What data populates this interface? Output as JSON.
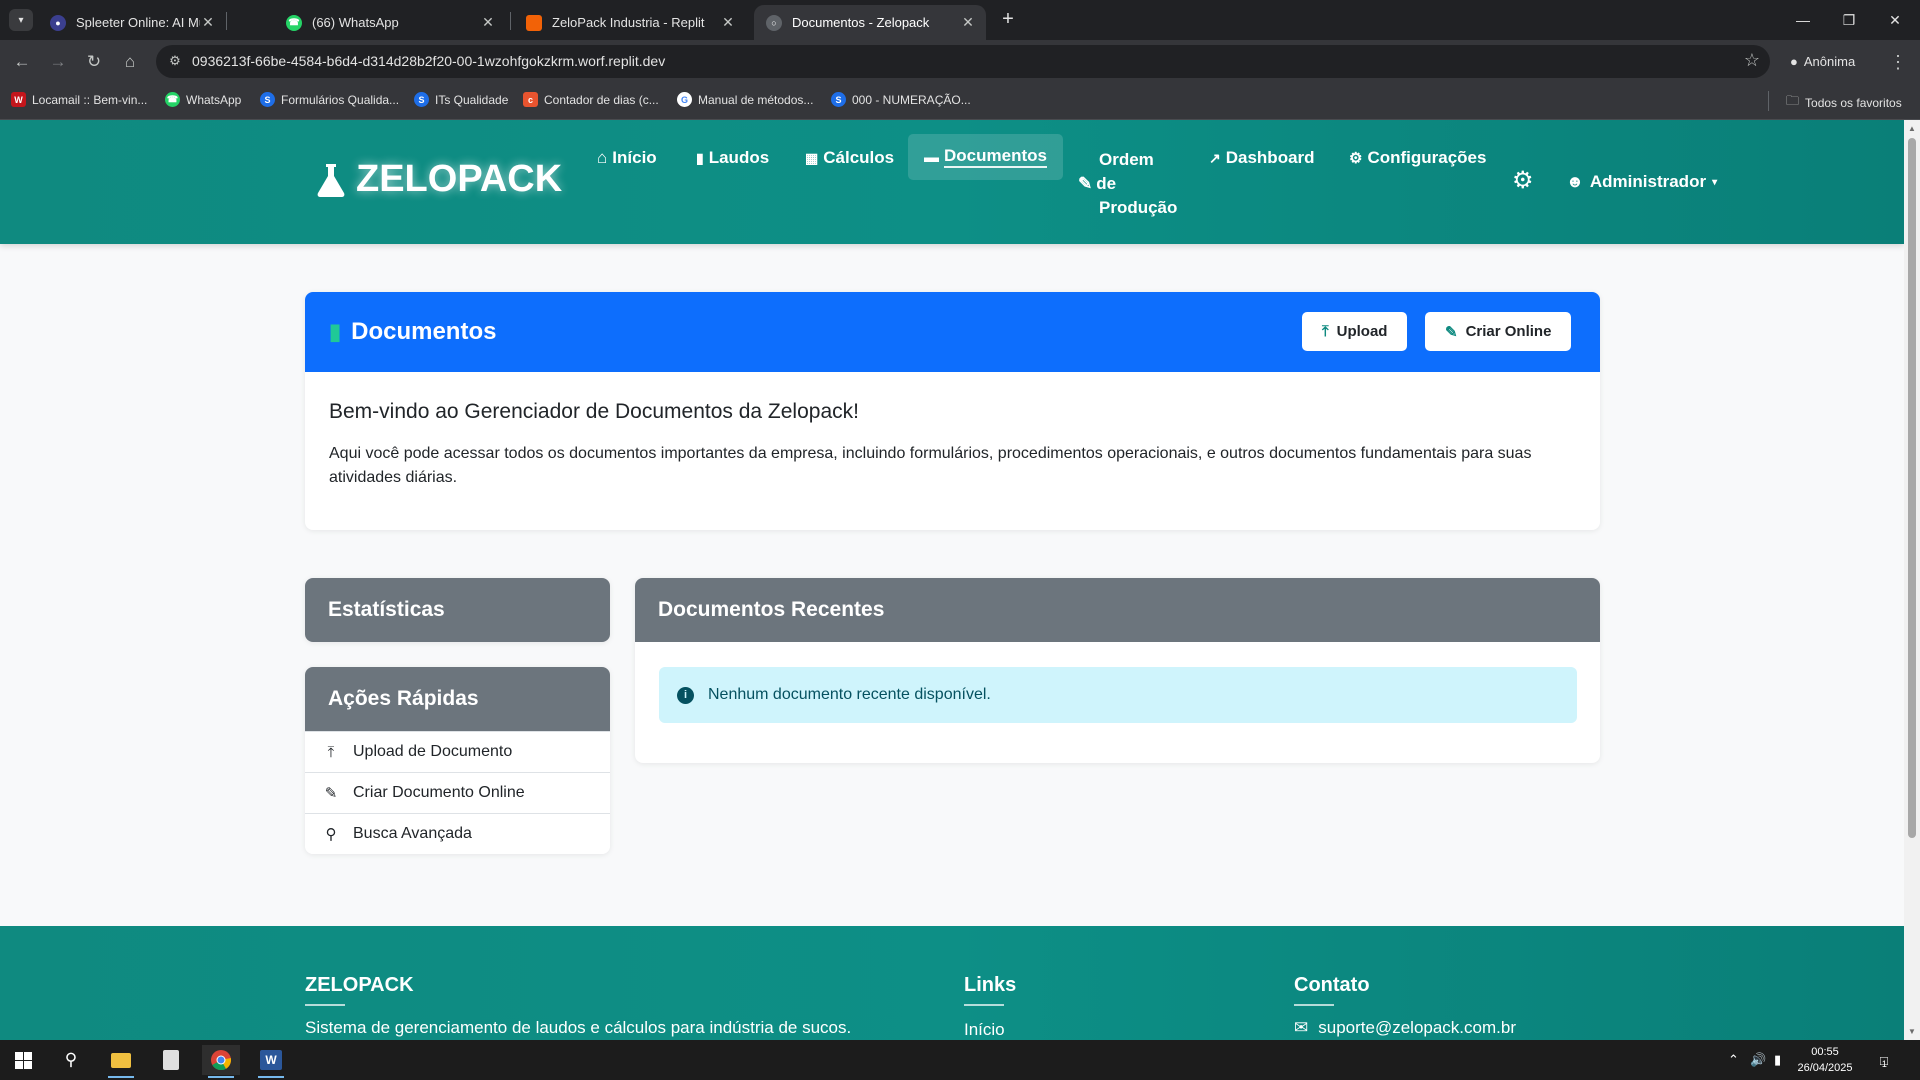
{
  "browser": {
    "tabs": [
      {
        "title": "Spleeter Online: AI Music Sourc",
        "favicon_color": "#3b3f8f"
      },
      {
        "title": "(66) WhatsApp",
        "favicon_color": "#25d366"
      },
      {
        "title": "ZeloPack Industria - Replit",
        "favicon_color": "#f26207"
      },
      {
        "title": "Documentos - Zelopack",
        "favicon_color": "#5f6368"
      }
    ],
    "active_tab_index": 3,
    "url": "0936213f-66be-4584-b6d4-d314d28b2f20-00-1wzohfgokzkrm.worf.replit.dev",
    "profile_label": "Anônima",
    "bookmarks": [
      {
        "label": "Locamail :: Bem-vin...",
        "icon": "W",
        "color": "#c4161c"
      },
      {
        "label": "WhatsApp",
        "icon": "wa",
        "color": "#25d366"
      },
      {
        "label": "Formulários Qualida...",
        "icon": "S",
        "color": "#1e6ee8"
      },
      {
        "label": "ITs Qualidade",
        "icon": "S",
        "color": "#1e6ee8"
      },
      {
        "label": "Contador de dias (c...",
        "icon": "c",
        "color": "#e8542f"
      },
      {
        "label": "Manual de métodos...",
        "icon": "G",
        "color": "#ffffff"
      },
      {
        "label": "000 - NUMERAÇÃO...",
        "icon": "S",
        "color": "#1e6ee8"
      }
    ],
    "all_bookmarks_label": "Todos os favoritos"
  },
  "app": {
    "brand": "ZELOPACK",
    "nav": {
      "inicio": "Início",
      "laudos": "Laudos",
      "calculos": "Cálculos",
      "documentos": "Documentos",
      "ordem_line1": "Ordem",
      "ordem_line2": "de",
      "ordem_line3": "Produção",
      "dashboard": "Dashboard",
      "configuracoes": "Configurações",
      "user": "Administrador"
    },
    "docs": {
      "title": "Documentos",
      "upload_label": "Upload",
      "create_label": "Criar Online",
      "welcome": "Bem-vindo ao Gerenciador de Documentos da Zelopack!",
      "description": "Aqui você pode acessar todos os documentos importantes da empresa, incluindo formulários, procedimentos operacionais, e outros documentos fundamentais para suas atividades diárias."
    },
    "stats": {
      "title": "Estatísticas"
    },
    "quick_actions": {
      "title": "Ações Rápidas",
      "items": [
        {
          "label": "Upload de Documento"
        },
        {
          "label": "Criar Documento Online"
        },
        {
          "label": "Busca Avançada"
        }
      ]
    },
    "recent": {
      "title": "Documentos Recentes",
      "empty_message": "Nenhum documento recente disponível."
    },
    "footer": {
      "brand": "ZELOPACK",
      "tagline": "Sistema de gerenciamento de laudos e cálculos para indústria de sucos.",
      "links_title": "Links",
      "link_inicio": "Início",
      "contact_title": "Contato",
      "email": "suporte@zelopack.com.br"
    }
  },
  "taskbar": {
    "time": "00:55",
    "date": "26/04/2025",
    "notification_count": "1"
  }
}
